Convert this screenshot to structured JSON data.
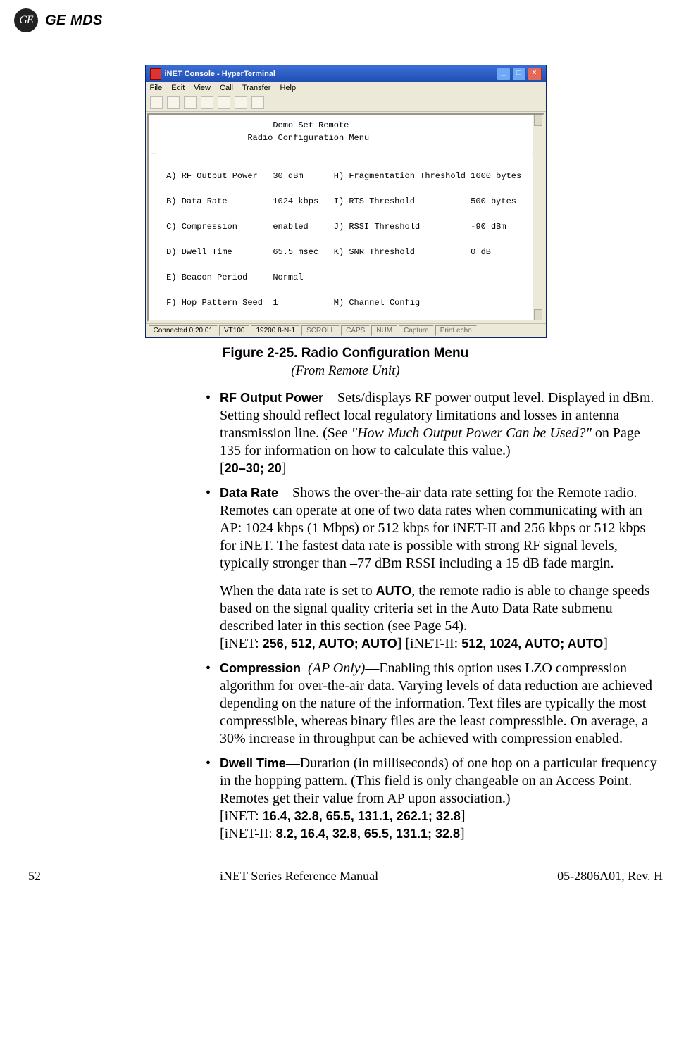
{
  "header": {
    "logo_text": "GE",
    "brand": "GE MDS"
  },
  "window": {
    "title": "iNET Console - HyperTerminal",
    "menus": [
      "File",
      "Edit",
      "View",
      "Call",
      "Transfer",
      "Help"
    ],
    "terminal_text": "                        Demo Set Remote\n                   Radio Configuration Menu\n_==========================================================================_\n\n   A) RF Output Power   30 dBm      H) Fragmentation Threshold 1600 bytes\n\n   B) Data Rate         1024 kbps   I) RTS Threshold           500 bytes\n\n   C) Compression       enabled     J) RSSI Threshold          -90 dBm\n\n   D) Dwell Time        65.5 msec   K) SNR Threshold           0 dB\n\n   E) Beacon Period     Normal\n\n   F) Hop Pattern Seed  1           M) Channel Config\n\n   G) Mobility Configuration        N) Auto Data Rate Config\n\n\n            This field is read-only, while device is a Remote.\n       Select a letter to configure an item, <ESC> for the prev menu  _",
    "status": {
      "connected": "Connected 0:20:01",
      "emu": "VT100",
      "port": "19200 8-N-1",
      "fields": [
        "SCROLL",
        "CAPS",
        "NUM",
        "Capture",
        "Print echo"
      ]
    }
  },
  "figure": {
    "label": "Figure 2-25. Radio Configuration Menu",
    "subtitle": "(From Remote Unit)"
  },
  "bullets": {
    "b1_label": "RF Output Power",
    "b1_text": "—Sets/displays RF power output level. Displayed in dBm. Setting should reflect local regulatory limitations and losses in antenna transmission line. (See ",
    "b1_quote": "\"How Much Output Power Can be Used?\"",
    "b1_text_after": " on Page 135 for information on how to calculate this value.)",
    "b1_range": "20–30; 20",
    "b2_label": "Data Rate",
    "b2_text": "—Shows the over-the-air data rate setting for the Remote radio. Remotes can operate at one of two data rates when communicating with an AP: 1024 kbps (1 Mbps) or 512 kbps for iNET-II and 256 kbps or 512 kbps for iNET. The fastest data rate is possible with strong RF signal levels, typically stronger than –77 dBm RSSI including a 15 dB fade margin.",
    "b2_para2_a": "When the data rate is set to ",
    "b2_auto": "AUTO",
    "b2_para2_b": ", the remote radio is able to change speeds based on the signal quality criteria set in the Auto Data Rate submenu described later in this section (see Page 54).",
    "b2_line3_a": "[iNET: ",
    "b2_line3_b": "256, 512, AUTO; AUTO",
    "b2_line3_c": "] [iNET-II: ",
    "b2_line3_d": "512, 1024, AUTO; AUTO",
    "b2_line3_e": "]",
    "b3_label": "Compression",
    "b3_note": "(AP Only)",
    "b3_text": "—Enabling this option uses LZO compression algorithm for over-the-air data. Varying levels of data reduction are achieved depending on the nature of the information. Text files are typically the most compressible, whereas binary files are the least compressible. On average, a 30% increase in throughput can be achieved with compression enabled.",
    "b4_label": "Dwell Time",
    "b4_text": "—Duration (in milliseconds) of one hop on a particular frequency in the hopping pattern. (This field is only changeable on an Access Point. Remotes get their value from AP upon association.)",
    "b4_line2_a": "[iNET: ",
    "b4_line2_b": "16.4, 32.8, 65.5, 131.1, 262.1; 32.8",
    "b4_line2_c": "]",
    "b4_line3_a": "[iNET-II: ",
    "b4_line3_b": "8.2, 16.4, 32.8, 65.5, 131.1; 32.8",
    "b4_line3_c": "]"
  },
  "footer": {
    "page": "52",
    "center": "iNET Series Reference Manual",
    "right": "05-2806A01, Rev. H"
  }
}
